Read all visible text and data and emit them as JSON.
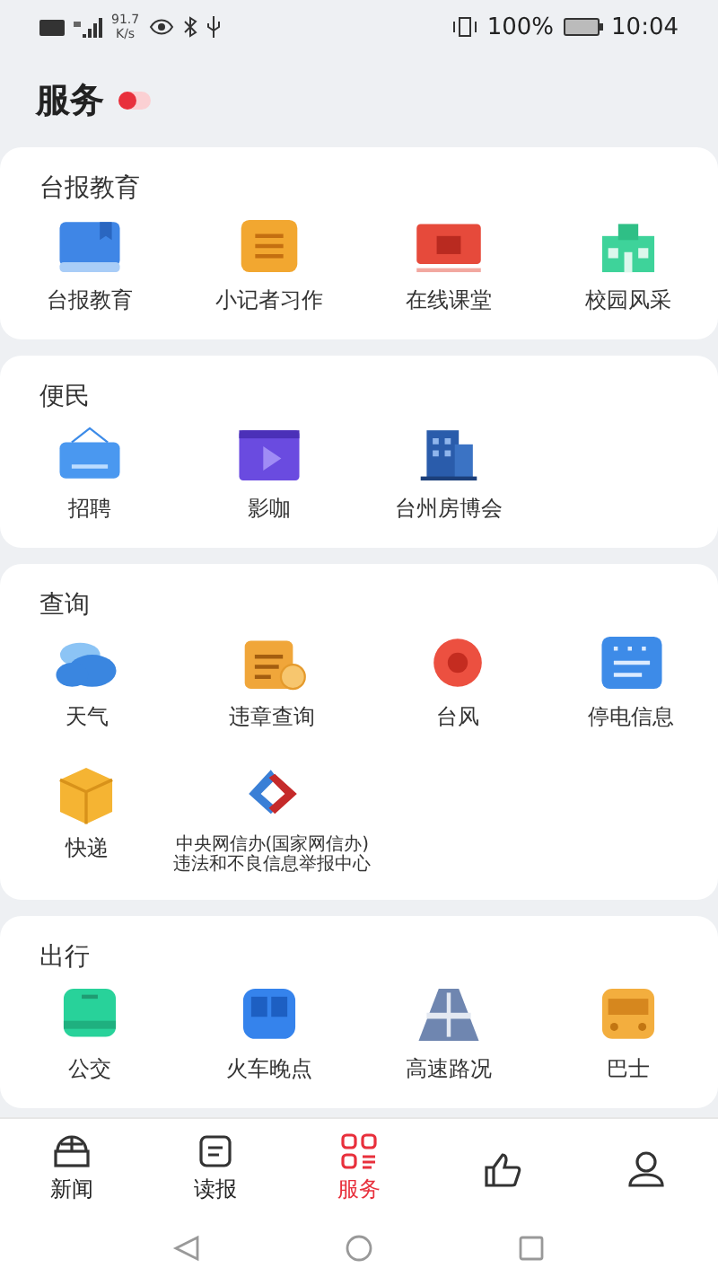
{
  "status_bar": {
    "speed_value": "91.7",
    "speed_unit": "K/s",
    "battery": "100%",
    "time": "10:04"
  },
  "header": {
    "title": "服务"
  },
  "sections": [
    {
      "title": "台报教育",
      "items": [
        {
          "label": "台报教育"
        },
        {
          "label": "小记者习作"
        },
        {
          "label": "在线课堂"
        },
        {
          "label": "校园风采"
        }
      ]
    },
    {
      "title": "便民",
      "items": [
        {
          "label": "招聘"
        },
        {
          "label": "影咖"
        },
        {
          "label": "台州房博会"
        }
      ]
    },
    {
      "title": "查询",
      "items": [
        {
          "label": "天气"
        },
        {
          "label": "违章查询"
        },
        {
          "label": "台风"
        },
        {
          "label": "停电信息"
        },
        {
          "label": "快递"
        },
        {
          "label": "中央网信办(国家网信办)\n违法和不良信息举报中心",
          "kind": "small"
        }
      ]
    },
    {
      "title": "出行",
      "items": [
        {
          "label": "公交"
        },
        {
          "label": "火车晚点"
        },
        {
          "label": "高速路况"
        },
        {
          "label": "巴士"
        }
      ]
    }
  ],
  "tabs": [
    {
      "label": "新闻",
      "selected": false
    },
    {
      "label": "读报",
      "selected": false
    },
    {
      "label": "服务",
      "selected": true
    },
    {
      "selected": false
    },
    {
      "selected": false
    }
  ]
}
